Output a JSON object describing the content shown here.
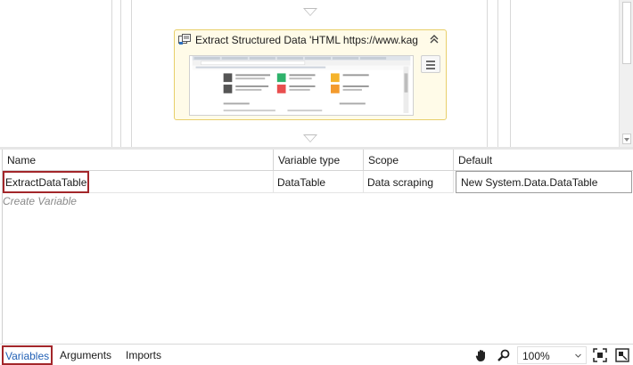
{
  "activity": {
    "title": "Extract Structured Data 'HTML  https://www.kag"
  },
  "variables_grid": {
    "columns": [
      "Name",
      "Variable type",
      "Scope",
      "Default"
    ],
    "rows": [
      {
        "name": "ExtractDataTable",
        "type": "DataTable",
        "scope": "Data scraping",
        "default": "New System.Data.DataTable"
      }
    ],
    "create_label": "Create Variable"
  },
  "bottom_bar": {
    "tabs": [
      "Variables",
      "Arguments",
      "Imports"
    ],
    "active_tab": "Variables",
    "zoom": "100%"
  },
  "icons": {
    "activity": "extract-data-icon",
    "collapse": "double-chevron-up-icon",
    "menu": "hamburger-menu-icon",
    "pan": "hand-icon",
    "search": "magnifier-icon",
    "fit": "fit-to-screen-icon",
    "overview": "overview-icon"
  },
  "colors": {
    "activity_bg": "#fffbe8",
    "activity_border": "#e8cf6a",
    "highlight": "#a3262a",
    "active_tab_text": "#2160b5"
  }
}
